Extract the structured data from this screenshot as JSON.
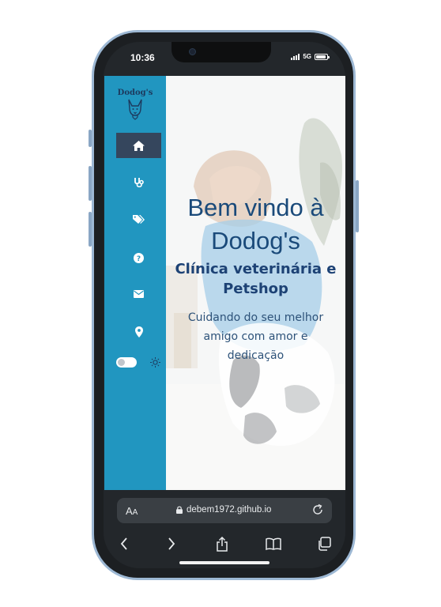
{
  "status_bar": {
    "time": "10:36",
    "network": "5G",
    "battery_level": 0.9
  },
  "site": {
    "logo_text": "Dodog's",
    "nav": [
      {
        "name": "home",
        "icon": "home-icon",
        "active": true
      },
      {
        "name": "services",
        "icon": "stethoscope-icon",
        "active": false
      },
      {
        "name": "products",
        "icon": "tags-icon",
        "active": false
      },
      {
        "name": "faq",
        "icon": "question-circle-icon",
        "active": false
      },
      {
        "name": "contact",
        "icon": "envelope-icon",
        "active": false
      },
      {
        "name": "location",
        "icon": "map-marker-icon",
        "active": false
      }
    ],
    "theme_toggle": {
      "dark_mode": false,
      "icon": "sun-icon"
    },
    "hero": {
      "title": "Bem vindo à Dodog's",
      "subtitle": "Clínica veterinária e Petshop",
      "tagline": "Cuidando do seu melhor amigo com amor e dedicação"
    },
    "colors": {
      "sidebar": "#2196c0",
      "active_nav": "#35465d",
      "title": "#1a4a7a"
    }
  },
  "browser": {
    "text_size_label": "AA",
    "url": "debem1972.github.io",
    "buttons": [
      "back-icon",
      "forward-icon",
      "share-icon",
      "bookmarks-icon",
      "tabs-icon"
    ]
  }
}
